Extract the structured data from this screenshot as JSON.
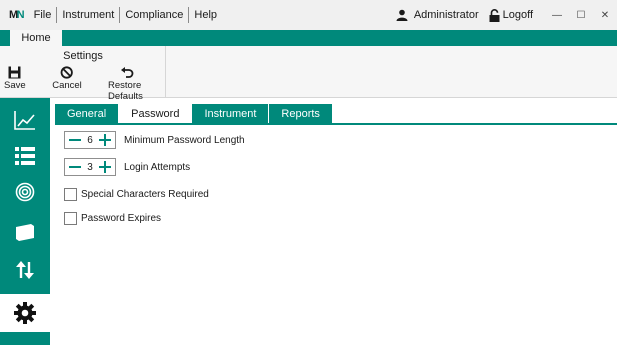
{
  "app": {
    "logo_main": "M",
    "logo_accent": "N"
  },
  "menu": {
    "file": "File",
    "instrument": "Instrument",
    "compliance": "Compliance",
    "help": "Help"
  },
  "user": {
    "name": "Administrator",
    "logoff": "Logoff"
  },
  "window": {
    "minimize": "—",
    "maximize": "☐",
    "close": "✕"
  },
  "ribbon": {
    "tab_home": "Home",
    "group_label": "Settings",
    "save": "Save",
    "cancel": "Cancel",
    "restore_defaults": "Restore Defaults"
  },
  "sidebar": {
    "items": [
      "chart-icon",
      "list-icon",
      "fingerprint-icon",
      "package-icon",
      "transfer-icon",
      "gear-icon"
    ],
    "active": "gear-icon"
  },
  "tabs": {
    "general": "General",
    "password": "Password",
    "instrument": "Instrument",
    "reports": "Reports",
    "active": "Password"
  },
  "password": {
    "min_length_value": "6",
    "min_length_label": "Minimum Password Length",
    "login_attempts_value": "3",
    "login_attempts_label": "Login Attempts",
    "special_chars_label": "Special Characters Required",
    "special_chars_checked": false,
    "expires_label": "Password Expires",
    "expires_checked": false
  },
  "colors": {
    "accent": "#00897b",
    "background": "#ffffff",
    "ribbon": "#f6f6f6",
    "menubar": "#f0f0f0"
  }
}
